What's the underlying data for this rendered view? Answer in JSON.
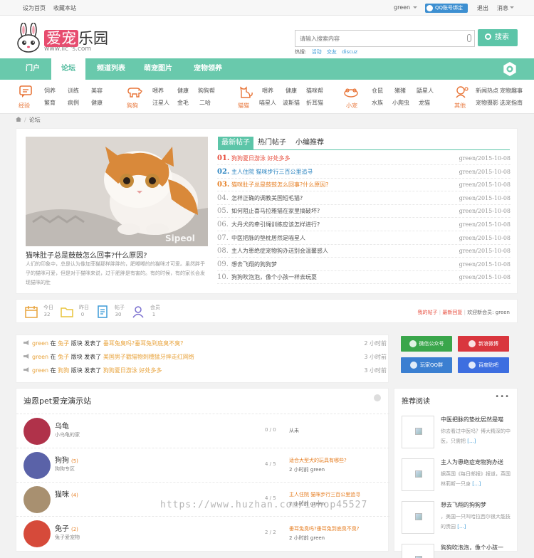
{
  "topbar": {
    "set_home": "设为首页",
    "bookmark": "收藏本站",
    "username": "green",
    "qq_bind": "QQ账号绑定",
    "logout": "退出",
    "messages": "消息"
  },
  "logo": {
    "text_pink": "爱宠",
    "text_dark": "乐园",
    "url": "www.ilc       's.com"
  },
  "search": {
    "placeholder": "请输入搜索内容",
    "button": "搜索",
    "hot_label": "热搜:",
    "hot_words": [
      "活动",
      "交友",
      "discuz"
    ]
  },
  "nav": {
    "items": [
      "门户",
      "论坛",
      "频道列表",
      "萌宠图片",
      "宠物领养"
    ],
    "active": 1
  },
  "subnav": [
    {
      "cat": "经验",
      "color": "#e8763a",
      "links": [
        "饲养",
        "训练",
        "美容",
        "繁育",
        "病例",
        "健康"
      ]
    },
    {
      "cat": "狗狗",
      "color": "#e8763a",
      "links": [
        "喂养",
        "健康",
        "狗狗帮",
        "汪星人",
        "金毛",
        "二哈"
      ]
    },
    {
      "cat": "猫猫",
      "color": "#e8763a",
      "links": [
        "喂养",
        "健康",
        "猫咪帮",
        "喵星人",
        "波斯猫",
        "折耳猫"
      ]
    },
    {
      "cat": "小宠",
      "color": "#e8763a",
      "links": [
        "仓鼠",
        "猪猪",
        "鼯星人",
        "水族",
        "小爬虫",
        "龙猫"
      ]
    },
    {
      "cat": "其他",
      "color": "#e8763a",
      "links": [
        "新闻热点",
        "宠物趣事",
        "宠物摄影",
        "选宠指南"
      ]
    }
  ],
  "breadcrumb": {
    "current": "论坛"
  },
  "hero": {
    "title": "猫咪肚子总是鼓鼓怎么回事?什么原因?",
    "desc": "人们的印象中，总是认为像加菲猫那样胖胖的，肥嘟嘟的的猫咪才可爱。虽然胖乎乎的猫咪可爱，但是对于猫咪来说，过于肥胖是有害的。有的时候，有的家长会发现猫咪的肚",
    "watermark_text": "Sipeol"
  },
  "tabs": [
    "最新帖子",
    "热门帖子",
    "小编推荐"
  ],
  "posts": [
    {
      "num": "01.",
      "title": "狗狗夏日游泳 好处多多",
      "meta": "green/2015-10-08",
      "color": "#e74c3c"
    },
    {
      "num": "02.",
      "title": "主人住院 猫咪步行三百公里追寻",
      "meta": "green/2015-10-08",
      "color": "#2e86c1"
    },
    {
      "num": "03.",
      "title": "猫咪肚子总是鼓鼓怎么回事?什么原因?",
      "meta": "green/2015-10-08",
      "color": "#e67e22"
    },
    {
      "num": "04.",
      "title": "怎样正确的调教美国短毛猫?",
      "meta": "green/2015-10-08",
      "color": "#555555"
    },
    {
      "num": "05.",
      "title": "如何阻止喜马拉雅猫在家里搞破坏?",
      "meta": "green/2015-10-08",
      "color": "#555555"
    },
    {
      "num": "06.",
      "title": "大丹犬的牵引绳训练应该怎样进行?",
      "meta": "green/2015-10-08",
      "color": "#555555"
    },
    {
      "num": "07.",
      "title": "中医把脉的垫枕居然是喵星人",
      "meta": "green/2015-10-08",
      "color": "#555555"
    },
    {
      "num": "08.",
      "title": "主人为患绝症宠物狗办送别会温馨感人",
      "meta": "green/2015-10-08",
      "color": "#555555"
    },
    {
      "num": "09.",
      "title": "想去飞翔的狗狗梦",
      "meta": "green/2015-10-08",
      "color": "#555555"
    },
    {
      "num": "10.",
      "title": "狗狗吹泡泡，像个小孩一样去玩耍",
      "meta": "green/2015-10-08",
      "color": "#555555"
    }
  ],
  "stats": [
    {
      "label": "今日",
      "value": "32",
      "color": "#e8a33c"
    },
    {
      "label": "昨日",
      "value": "0",
      "color": "#e8c33c"
    },
    {
      "label": "帖子",
      "value": "30",
      "color": "#3b9ad7"
    },
    {
      "label": "会员",
      "value": "1",
      "color": "#7a6fcf"
    }
  ],
  "stats_links": {
    "my_posts": "我的帖子",
    "latest_reply": "最新回复",
    "new_member_label": "欢迎新会员:",
    "new_member": "green"
  },
  "feed": [
    {
      "user": "green",
      "in": "在",
      "forum": "兔子",
      "mid": "版块 发表了",
      "title": "垂耳兔臭吗?垂耳兔到底臭不臭?",
      "time": "2 小时前"
    },
    {
      "user": "green",
      "in": "在",
      "forum": "兔子",
      "mid": "版块 发表了",
      "title": "美国男子戳猫物刺穗猛牙摔走红网络",
      "time": "3 小时前"
    },
    {
      "user": "green",
      "in": "在",
      "forum": "狗狗",
      "mid": "版块 发表了",
      "title": "狗狗夏日游泳 好处多多",
      "time": "3 小时前"
    }
  ],
  "social": [
    {
      "label": "微信公众号",
      "color": "#3aa64b"
    },
    {
      "label": "新浪微博",
      "color": "#d9363e"
    },
    {
      "label": "玩家QQ群",
      "color": "#3b7fd1"
    },
    {
      "label": "百度贴吧",
      "color": "#3d6ee0"
    }
  ],
  "forum": {
    "title": "迪恩pet爱宠演示站",
    "rows": [
      {
        "name": "乌龟",
        "count": "",
        "desc": "小乌龟的家",
        "ratio": "0 / 0",
        "last": "",
        "last_meta": "从未",
        "avatar_color": "#b0324a"
      },
      {
        "name": "狗狗",
        "count": "(5)",
        "desc": "狗狗专区",
        "ratio": "4 / 5",
        "last": "适合大型犬的玩具有哪些?",
        "last_meta": "2 小时前 green",
        "avatar_color": "#5a62a8"
      },
      {
        "name": "猫咪",
        "count": "(4)",
        "desc": "",
        "ratio": "4 / 5",
        "last": "主人住院 猫咪步行三百公里追寻",
        "last_meta": "2 小时前 green",
        "avatar_color": "#a89070"
      },
      {
        "name": "兔子",
        "count": "(2)",
        "desc": "兔子爱宠物",
        "ratio": "2 / 2",
        "last": "垂耳兔臭吗?垂耳兔到底臭不臭?",
        "last_meta": "2 小时前 green",
        "avatar_color": "#d64a3a"
      }
    ]
  },
  "recommend": {
    "title": "推荐阅读",
    "more": "•••",
    "items": [
      {
        "title": "中医把脉的垫枕居然是喵",
        "desc": "你去看过中医吗？博大精深的中医，只需把",
        "more": "[...]"
      },
      {
        "title": "主人为患绝症宠物狗办送",
        "desc": "据英国《每日邮报》报道，英国林莉斯一只身",
        "more": "[...]"
      },
      {
        "title": "想去飞翔的狗狗梦",
        "desc": "，美国一只叫哈拉西尔很大能技的贵园",
        "more": "[...]"
      },
      {
        "title": "狗狗吹泡泡，像个小孩一",
        "desc": "",
        "more": ""
      }
    ]
  },
  "watermark": "https://www.huzhan.com/ishop45527"
}
